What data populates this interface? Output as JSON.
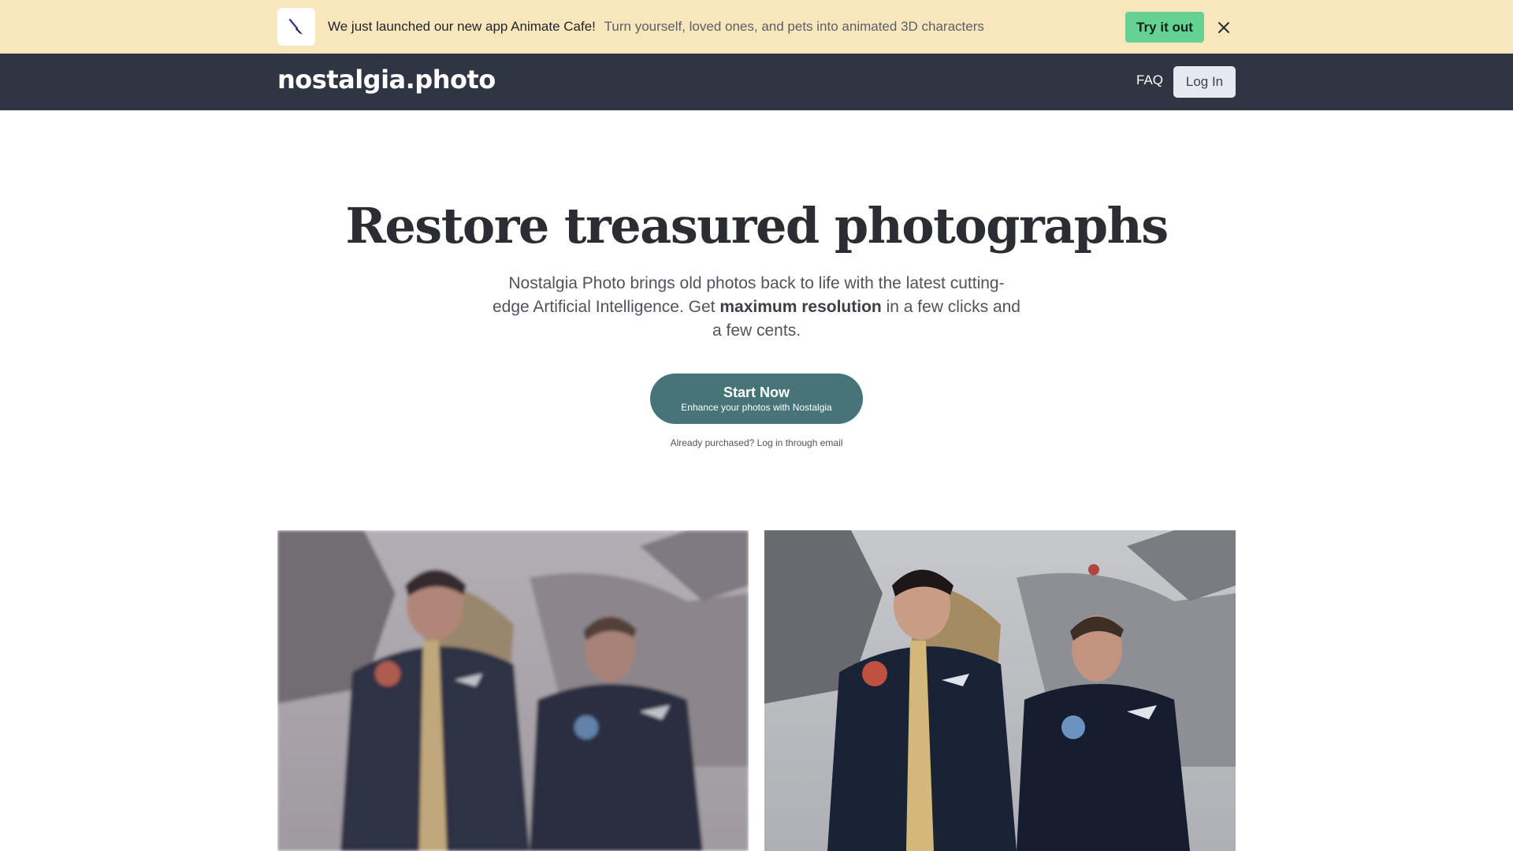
{
  "banner": {
    "icon": "brush-icon",
    "headline": "We just launched our new app Animate Cafe!",
    "description": "Turn yourself, loved ones, and pets into animated 3D characters",
    "cta_label": "Try it out",
    "close_icon": "close-icon",
    "background": "#f8e6bd",
    "cta_color": "#65d192"
  },
  "nav": {
    "logo": "nostalgia.photo",
    "faq_label": "FAQ",
    "login_label": "Log In",
    "background": "#2f3542"
  },
  "hero": {
    "title": "Restore treasured photographs",
    "subtitle_before": "Nostalgia Photo brings old photos back to life with the latest cutting-edge Artificial Intelligence. Get ",
    "subtitle_bold": "maximum resolution",
    "subtitle_after": " in a few clicks and a few cents.",
    "cta_title": "Start Now",
    "cta_subtitle": "Enhance your photos with Nostalgia",
    "cta_color": "#477479",
    "login_hint": "Already purchased? Log in through email"
  }
}
